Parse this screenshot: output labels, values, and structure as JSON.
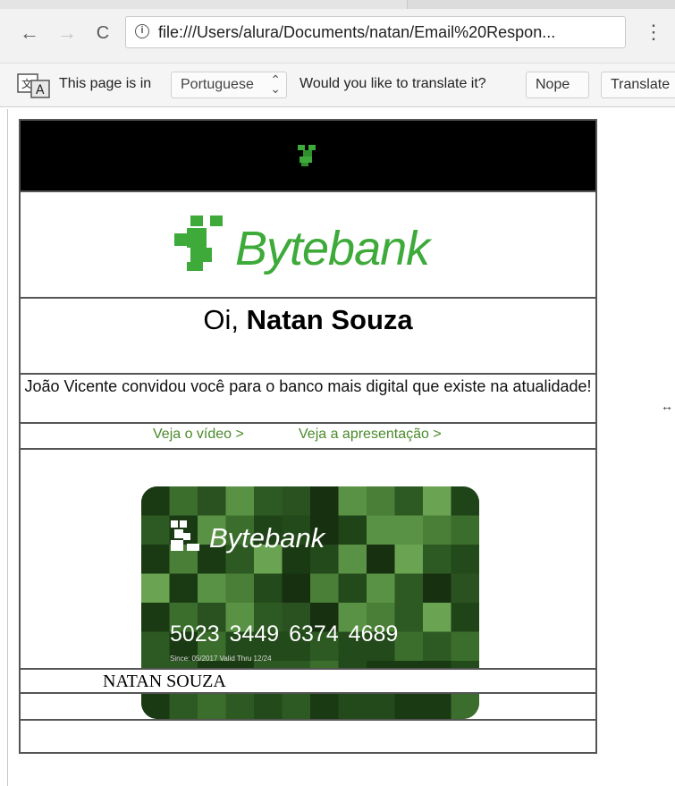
{
  "browser": {
    "url": "file:///Users/alura/Documents/natan/Email%20Respon...",
    "back_icon": "←",
    "forward_icon": "→",
    "reload_icon": "C",
    "menu_icon": "⋮"
  },
  "translate_bar": {
    "prefix": "This page is in",
    "language": "Portuguese",
    "question": "Would you like to translate it?",
    "nope_label": "Nope",
    "translate_label": "Translate"
  },
  "email": {
    "brand_name": "Bytebank",
    "greeting_prefix": "Oi, ",
    "greeting_name": "Natan Souza",
    "invite_text": "João Vicente convidou você para o banco mais digital que existe na atualidade!",
    "links": {
      "video": "Veja o vídeo >",
      "presentation": "Veja a apresentação >"
    },
    "card": {
      "brand": "Bytebank",
      "number": "5023 3449 6374 4689",
      "small_text": "Since: 05/2017  Valid Thru 12/24",
      "holder": "NATAN SOUZA"
    }
  },
  "colors": {
    "brand_green": "#3daa3a",
    "link_green": "#4a8a2a"
  }
}
